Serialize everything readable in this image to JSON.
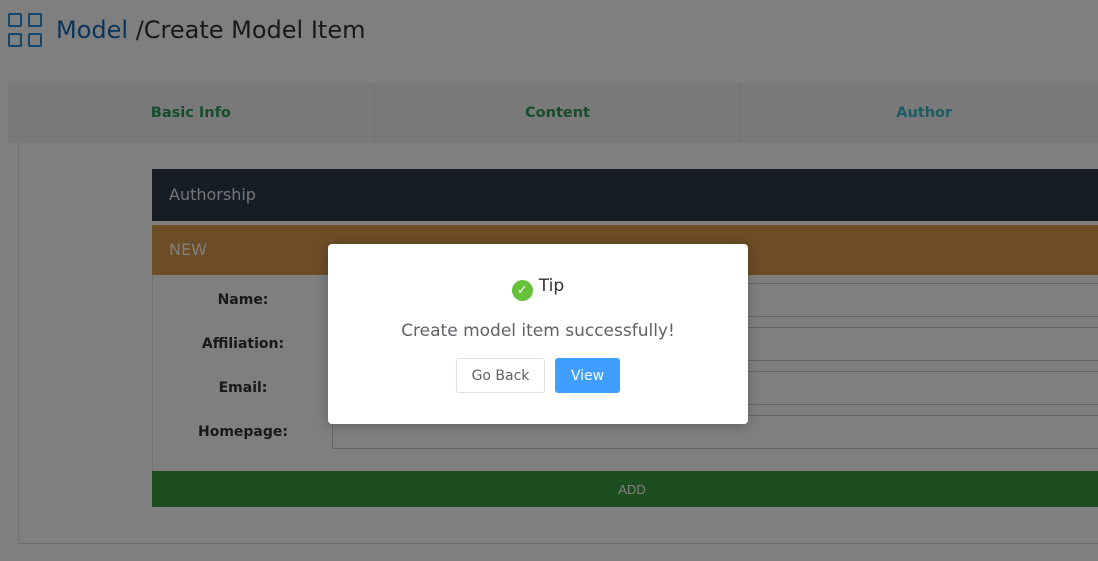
{
  "header": {
    "crumb_link": "Model",
    "crumb_current": "/Create Model Item",
    "icon": "grid-icon"
  },
  "tabs": [
    {
      "label": "Basic Info"
    },
    {
      "label": "Content"
    },
    {
      "label": "Author"
    }
  ],
  "authorship": {
    "title": "Authorship",
    "new_label": "NEW",
    "fields": [
      {
        "label": "Name:",
        "value": ""
      },
      {
        "label": "Affiliation:",
        "value": ""
      },
      {
        "label": "Email:",
        "value": ""
      },
      {
        "label": "Homepage:",
        "value": ""
      }
    ],
    "add_label": "ADD"
  },
  "modal": {
    "title": "Tip",
    "icon": "check-circle-icon",
    "message": "Create model item successfully!",
    "back_label": "Go Back",
    "view_label": "View"
  },
  "colors": {
    "primary": "#409eff",
    "success": "#67c23a",
    "auth_header": "#2d3a4b",
    "new_header": "#d89a4c",
    "add_bar": "#3a9d3f",
    "tab_text": "#2f9a5a",
    "link": "#1869b3"
  }
}
